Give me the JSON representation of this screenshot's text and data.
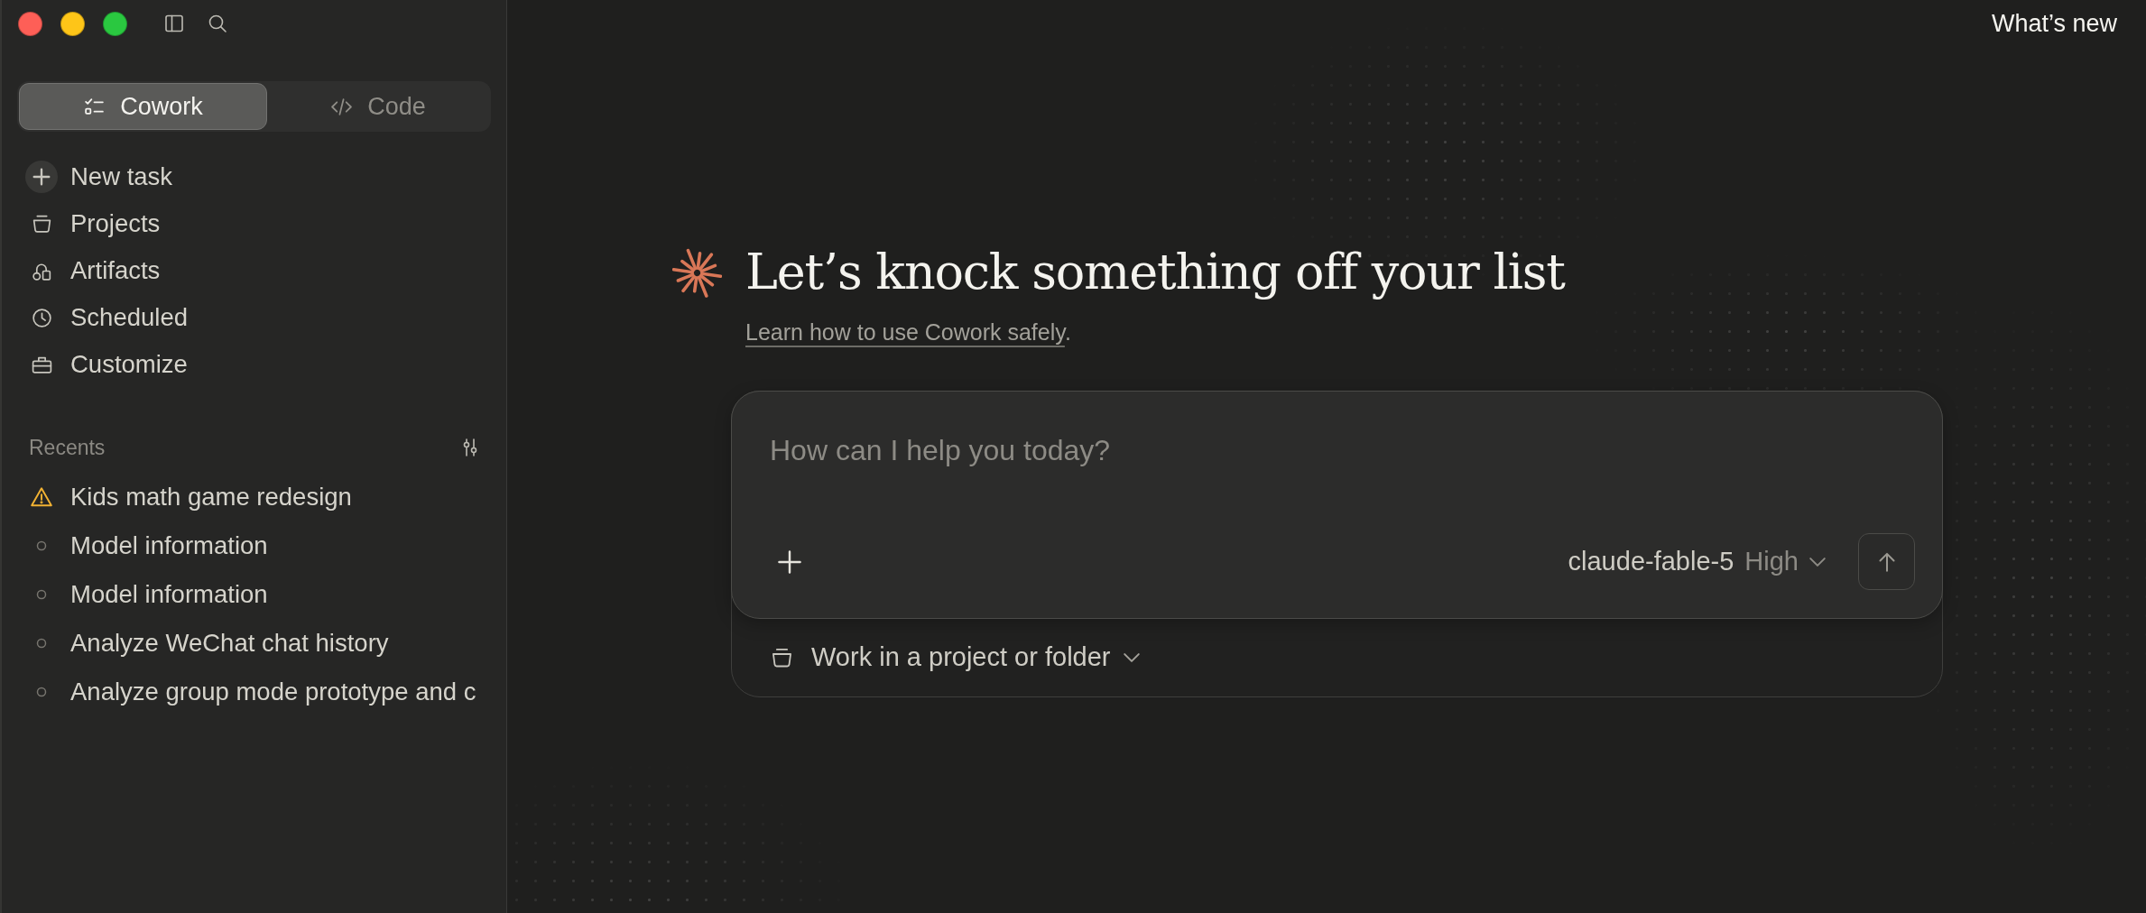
{
  "mode_switch": [
    {
      "label": "Cowork",
      "selected": true
    },
    {
      "label": "Code",
      "selected": false
    }
  ],
  "nav_items": [
    "New task",
    "Projects",
    "Artifacts",
    "Scheduled",
    "Customize"
  ],
  "recents": {
    "title": "Recents",
    "items": [
      {
        "label": "Kids math game redesign",
        "kind": "warning"
      },
      {
        "label": "Model information",
        "kind": "pending"
      },
      {
        "label": "Model information",
        "kind": "pending"
      },
      {
        "label": "Analyze WeChat chat history",
        "kind": "pending"
      },
      {
        "label": "Analyze group mode prototype and c",
        "kind": "pending"
      }
    ]
  },
  "header": {
    "whats_new": "What’s new"
  },
  "hero": {
    "title": "Let’s knock something off your list",
    "note_link": "Learn how to use Cowork safely",
    "note_end": "."
  },
  "composer": {
    "placeholder": "How can I help you today?",
    "model": "claude-fable-5",
    "effort": "High",
    "folder_picker": "Work in a project or folder"
  }
}
